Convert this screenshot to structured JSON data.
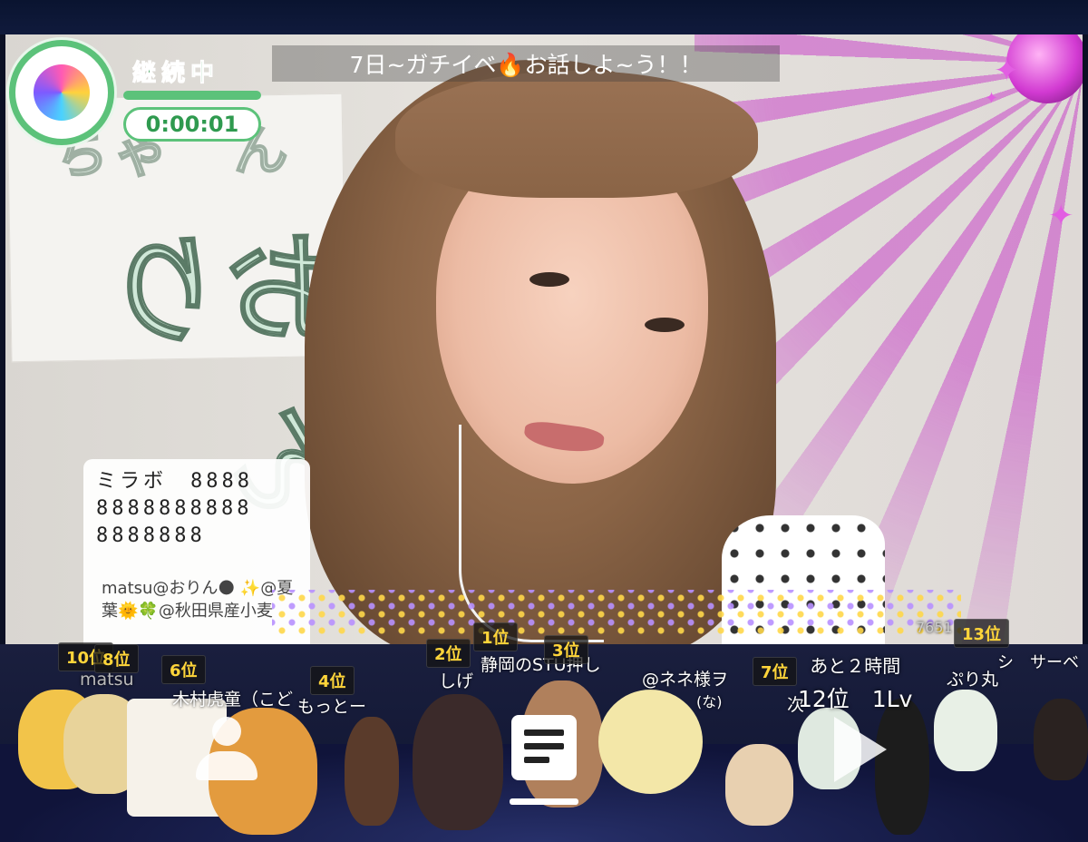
{
  "stream": {
    "title": "7日~ガチイベ🔥お話しよ~う！！",
    "status_label": "継続中",
    "timer": "0:00:01"
  },
  "poster": {
    "line1": "ちゃ゛ん",
    "line2": "おりん"
  },
  "comment_card": {
    "main_text": "ミラボ　8888\n8888888888\n8888888",
    "sub_text": "matsu@おりん🌑 ✨@夏葉🌞🍀@秋田県産小麦"
  },
  "rankings": [
    {
      "rank": "10位",
      "name": ""
    },
    {
      "rank": "8位",
      "name": ""
    },
    {
      "rank": "6位",
      "name": "木村虎童（こど"
    },
    {
      "rank": "4位",
      "name": "もっとー"
    },
    {
      "rank": "2位",
      "name": "しげ"
    },
    {
      "rank": "1位",
      "name": "静岡のSTU押し"
    },
    {
      "rank": "3位",
      "name": "@ネネ様ヲ"
    },
    {
      "rank": "7位",
      "name": "次"
    },
    {
      "rank": "13位",
      "name": "ぷり丸"
    }
  ],
  "fragments": {
    "matsu": "matsu",
    "count_small": "7651",
    "tail_name": "シ　サーベ",
    "na": "(な)"
  },
  "rank_info": {
    "remaining": "あと２時間",
    "current": "12位　1Lv"
  },
  "colors": {
    "status_green": "#5cc27a",
    "rank_gold": "#ffd53a",
    "ray_pink": "#d23ad2"
  },
  "icons": [
    "user-icon",
    "menu-icon",
    "next-arrow-icon",
    "disco-ball-icon"
  ]
}
